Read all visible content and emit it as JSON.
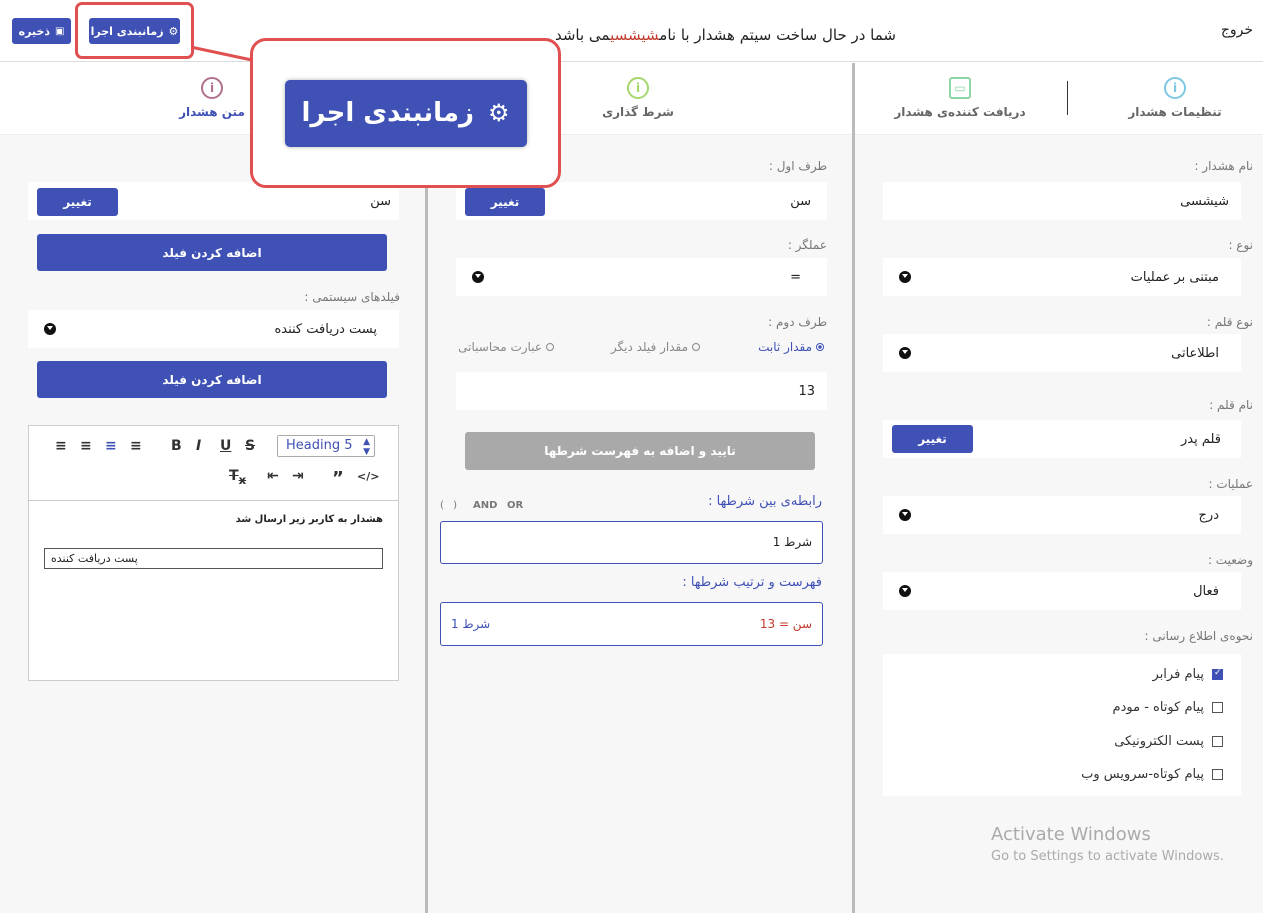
{
  "topbar": {
    "exit_label": "خروج",
    "headline_prefix": "شما در حال ساخت سیتم هشدار با نام",
    "headline_name": "شیشسی",
    "headline_suffix": "می باشد",
    "schedule_label": "زمانبندی اجرا",
    "save_label": "ذخیره"
  },
  "callout": {
    "label": "زمانبندی اجرا"
  },
  "tabs": {
    "settings": "تنظیمات هشدار",
    "receiver": "دریافت کننده‌ی هشدار",
    "condition": "شرط گذاری",
    "text": "متن هشدار"
  },
  "settings_panel": {
    "name_label": "نام هشدار :",
    "name_value": "شیشسی",
    "type_label": "نوع :",
    "type_value": "مبتنی بر عملیات",
    "item_type_label": "نوع قلم :",
    "item_type_value": "اطلاعاتی",
    "item_name_label": "نام قلم :",
    "item_name_value": "قلم پدر",
    "change_label": "تغییر",
    "operations_label": "عملیات :",
    "operations_value": "درج",
    "status_label": "وضعیت :",
    "status_value": "فعال",
    "notify_label": "نحوه‌ی اطلاع رسانی :",
    "notify_options": [
      {
        "label": "پیام فرابر",
        "checked": true
      },
      {
        "label": "پیام کوتاه - مودم",
        "checked": false
      },
      {
        "label": "پست الکترونیکی",
        "checked": false
      },
      {
        "label": "پیام کوتاه-سرویس وب",
        "checked": false
      }
    ]
  },
  "condition_panel": {
    "first_label": "طرف اول :",
    "first_value": "سن",
    "change_label": "تغییر",
    "operator_label": "عملگر :",
    "operator_value": "=",
    "second_label": "طرف دوم :",
    "radio_fixed": "مقدار ثابت",
    "radio_other": "مقدار فیلد دیگر",
    "radio_calc": "عبارت محاسباتی",
    "second_value": "13",
    "confirm_label": "تایید و اضافه به فهرست شرطها",
    "relation_label": "رابطه‌ی بین شرطها :",
    "op_or": "OR",
    "op_and": "AND",
    "op_paren": "( )",
    "relation_value": "شرط 1",
    "list_label": "فهرست و ترتیب شرطها :",
    "list_item_expr": "سن = 13",
    "list_item_name": "شرط 1"
  },
  "text_panel": {
    "field_value": "سن",
    "change_label": "تغییر",
    "add_field_label": "اضافه کردن فیلد",
    "system_fields_label": "فیلدهای سیستمی :",
    "system_field_value": "پست دریافت کننده",
    "add_field_label2": "اضافه کردن فیلد",
    "heading_select": "Heading 5",
    "editor_line1": "هشدار به کاربر زیر ارسال شد",
    "editor_line2": "پست دریافت کننده"
  },
  "watermark": {
    "line1": "Activate Windows",
    "line2": "Go to Settings to activate Windows."
  },
  "colors": {
    "accent": "#3f51b5",
    "highlight": "#e05050"
  }
}
